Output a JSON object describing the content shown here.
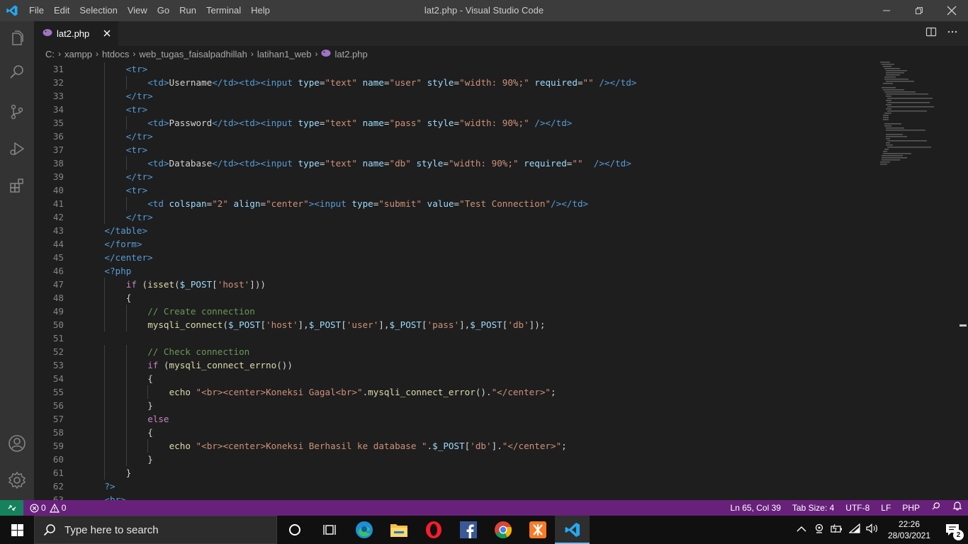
{
  "window": {
    "title": "lat2.php - Visual Studio Code",
    "menu": [
      "File",
      "Edit",
      "Selection",
      "View",
      "Go",
      "Run",
      "Terminal",
      "Help"
    ]
  },
  "tab": {
    "label": "lat2.php"
  },
  "breadcrumb": [
    "C:",
    "xampp",
    "htdocs",
    "web_tugas_faisalpadhillah",
    "latihan1_web",
    "lat2.php"
  ],
  "editor": {
    "lines": [
      {
        "n": "31",
        "indent": 2,
        "tokens": [
          [
            "tag",
            "<tr>"
          ]
        ]
      },
      {
        "n": "32",
        "indent": 3,
        "tokens": [
          [
            "tag",
            "<td>"
          ],
          [
            "text",
            "Username"
          ],
          [
            "tag",
            "</td><td>"
          ],
          [
            "tag",
            "<input "
          ],
          [
            "attr",
            "type"
          ],
          [
            "text",
            "="
          ],
          [
            "str",
            "\"text\""
          ],
          [
            "text",
            " "
          ],
          [
            "attr",
            "name"
          ],
          [
            "text",
            "="
          ],
          [
            "str",
            "\"user\""
          ],
          [
            "text",
            " "
          ],
          [
            "attr",
            "style"
          ],
          [
            "text",
            "="
          ],
          [
            "str",
            "\"width: 90%;\""
          ],
          [
            "text",
            " "
          ],
          [
            "attr",
            "required"
          ],
          [
            "text",
            "="
          ],
          [
            "str",
            "\"\""
          ],
          [
            "text",
            " "
          ],
          [
            "tag",
            "/></td>"
          ]
        ]
      },
      {
        "n": "33",
        "indent": 2,
        "tokens": [
          [
            "tag",
            "</tr>"
          ]
        ]
      },
      {
        "n": "34",
        "indent": 2,
        "tokens": [
          [
            "tag",
            "<tr>"
          ]
        ]
      },
      {
        "n": "35",
        "indent": 3,
        "tokens": [
          [
            "tag",
            "<td>"
          ],
          [
            "text",
            "Password"
          ],
          [
            "tag",
            "</td><td>"
          ],
          [
            "tag",
            "<input "
          ],
          [
            "attr",
            "type"
          ],
          [
            "text",
            "="
          ],
          [
            "str",
            "\"text\""
          ],
          [
            "text",
            " "
          ],
          [
            "attr",
            "name"
          ],
          [
            "text",
            "="
          ],
          [
            "str",
            "\"pass\""
          ],
          [
            "text",
            " "
          ],
          [
            "attr",
            "style"
          ],
          [
            "text",
            "="
          ],
          [
            "str",
            "\"width: 90%;\""
          ],
          [
            "text",
            " "
          ],
          [
            "tag",
            "/></td>"
          ]
        ]
      },
      {
        "n": "36",
        "indent": 2,
        "tokens": [
          [
            "tag",
            "</tr>"
          ]
        ]
      },
      {
        "n": "37",
        "indent": 2,
        "tokens": [
          [
            "tag",
            "<tr>"
          ]
        ]
      },
      {
        "n": "38",
        "indent": 3,
        "tokens": [
          [
            "tag",
            "<td>"
          ],
          [
            "text",
            "Database"
          ],
          [
            "tag",
            "</td><td>"
          ],
          [
            "tag",
            "<input "
          ],
          [
            "attr",
            "type"
          ],
          [
            "text",
            "="
          ],
          [
            "str",
            "\"text\""
          ],
          [
            "text",
            " "
          ],
          [
            "attr",
            "name"
          ],
          [
            "text",
            "="
          ],
          [
            "str",
            "\"db\""
          ],
          [
            "text",
            " "
          ],
          [
            "attr",
            "style"
          ],
          [
            "text",
            "="
          ],
          [
            "str",
            "\"width: 90%;\""
          ],
          [
            "text",
            " "
          ],
          [
            "attr",
            "required"
          ],
          [
            "text",
            "="
          ],
          [
            "str",
            "\"\""
          ],
          [
            "text",
            "  "
          ],
          [
            "tag",
            "/></td>"
          ]
        ]
      },
      {
        "n": "39",
        "indent": 2,
        "tokens": [
          [
            "tag",
            "</tr>"
          ]
        ]
      },
      {
        "n": "40",
        "indent": 2,
        "tokens": [
          [
            "tag",
            "<tr>"
          ]
        ]
      },
      {
        "n": "41",
        "indent": 3,
        "tokens": [
          [
            "tag",
            "<td "
          ],
          [
            "attr",
            "colspan"
          ],
          [
            "text",
            "="
          ],
          [
            "str",
            "\"2\""
          ],
          [
            "text",
            " "
          ],
          [
            "attr",
            "align"
          ],
          [
            "text",
            "="
          ],
          [
            "str",
            "\"center\""
          ],
          [
            "tag",
            "><input "
          ],
          [
            "attr",
            "type"
          ],
          [
            "text",
            "="
          ],
          [
            "str",
            "\"submit\""
          ],
          [
            "text",
            " "
          ],
          [
            "attr",
            "value"
          ],
          [
            "text",
            "="
          ],
          [
            "str",
            "\"Test Connection\""
          ],
          [
            "tag",
            "/></td>"
          ]
        ]
      },
      {
        "n": "42",
        "indent": 2,
        "tokens": [
          [
            "tag",
            "</tr>"
          ]
        ]
      },
      {
        "n": "43",
        "indent": 1,
        "tokens": [
          [
            "tag",
            "</table>"
          ]
        ]
      },
      {
        "n": "44",
        "indent": 1,
        "tokens": [
          [
            "tag",
            "</form>"
          ]
        ]
      },
      {
        "n": "45",
        "indent": 1,
        "tokens": [
          [
            "tag",
            "</center>"
          ]
        ]
      },
      {
        "n": "46",
        "indent": 1,
        "tokens": [
          [
            "tag",
            "<?php"
          ]
        ]
      },
      {
        "n": "47",
        "indent": 2,
        "tokens": [
          [
            "kw",
            "if"
          ],
          [
            "text",
            " ("
          ],
          [
            "fn",
            "isset"
          ],
          [
            "text",
            "("
          ],
          [
            "var",
            "$_POST"
          ],
          [
            "text",
            "["
          ],
          [
            "str",
            "'host'"
          ],
          [
            "text",
            "]))"
          ]
        ]
      },
      {
        "n": "48",
        "indent": 2,
        "tokens": [
          [
            "text",
            "{"
          ]
        ]
      },
      {
        "n": "49",
        "indent": 3,
        "tokens": [
          [
            "com",
            "// Create connection"
          ]
        ]
      },
      {
        "n": "50",
        "indent": 3,
        "tokens": [
          [
            "fn",
            "mysqli_connect"
          ],
          [
            "text",
            "("
          ],
          [
            "var",
            "$_POST"
          ],
          [
            "text",
            "["
          ],
          [
            "str",
            "'host'"
          ],
          [
            "text",
            "],"
          ],
          [
            "var",
            "$_POST"
          ],
          [
            "text",
            "["
          ],
          [
            "str",
            "'user'"
          ],
          [
            "text",
            "],"
          ],
          [
            "var",
            "$_POST"
          ],
          [
            "text",
            "["
          ],
          [
            "str",
            "'pass'"
          ],
          [
            "text",
            "],"
          ],
          [
            "var",
            "$_POST"
          ],
          [
            "text",
            "["
          ],
          [
            "str",
            "'db'"
          ],
          [
            "text",
            "]);"
          ]
        ]
      },
      {
        "n": "51",
        "indent": 0,
        "tokens": []
      },
      {
        "n": "52",
        "indent": 3,
        "tokens": [
          [
            "com",
            "// Check connection"
          ]
        ]
      },
      {
        "n": "53",
        "indent": 3,
        "tokens": [
          [
            "kw",
            "if"
          ],
          [
            "text",
            " ("
          ],
          [
            "fn",
            "mysqli_connect_errno"
          ],
          [
            "text",
            "())"
          ]
        ]
      },
      {
        "n": "54",
        "indent": 3,
        "tokens": [
          [
            "text",
            "{"
          ]
        ]
      },
      {
        "n": "55",
        "indent": 4,
        "tokens": [
          [
            "fn",
            "echo"
          ],
          [
            "text",
            " "
          ],
          [
            "str",
            "\"<br><center>Koneksi Gagal<br>\""
          ],
          [
            "text",
            "."
          ],
          [
            "fn",
            "mysqli_connect_error"
          ],
          [
            "text",
            "()."
          ],
          [
            "str",
            "\"</center>\""
          ],
          [
            "text",
            ";"
          ]
        ]
      },
      {
        "n": "56",
        "indent": 3,
        "tokens": [
          [
            "text",
            "}"
          ]
        ]
      },
      {
        "n": "57",
        "indent": 3,
        "tokens": [
          [
            "kw",
            "else"
          ]
        ]
      },
      {
        "n": "58",
        "indent": 3,
        "tokens": [
          [
            "text",
            "{"
          ]
        ]
      },
      {
        "n": "59",
        "indent": 4,
        "tokens": [
          [
            "fn",
            "echo"
          ],
          [
            "text",
            " "
          ],
          [
            "str",
            "\"<br><center>Koneksi Berhasil ke database \""
          ],
          [
            "text",
            "."
          ],
          [
            "var",
            "$_POST"
          ],
          [
            "text",
            "["
          ],
          [
            "str",
            "'db'"
          ],
          [
            "text",
            "]."
          ],
          [
            "str",
            "\"</center>\""
          ],
          [
            "text",
            ";"
          ]
        ]
      },
      {
        "n": "60",
        "indent": 3,
        "tokens": [
          [
            "text",
            "}"
          ]
        ]
      },
      {
        "n": "61",
        "indent": 2,
        "tokens": [
          [
            "text",
            "}"
          ]
        ]
      },
      {
        "n": "62",
        "indent": 1,
        "tokens": [
          [
            "tag",
            "?>"
          ]
        ]
      },
      {
        "n": "63",
        "indent": 1,
        "tokens": [
          [
            "tag",
            "<br>"
          ]
        ]
      }
    ]
  },
  "statusbar": {
    "errors": "0",
    "warnings": "0",
    "position": "Ln 65, Col 39",
    "tab_size": "Tab Size: 4",
    "encoding": "UTF-8",
    "eol": "LF",
    "language": "PHP"
  },
  "taskbar": {
    "search_placeholder": "Type here to search",
    "time": "22:26",
    "date": "28/03/2021",
    "notification_count": "2"
  },
  "colors": {
    "statusbar": "#68217a",
    "remote": "#16825d",
    "titlebar": "#3c3c3c",
    "activitybar": "#333333",
    "editor_bg": "#1e1e1e"
  }
}
